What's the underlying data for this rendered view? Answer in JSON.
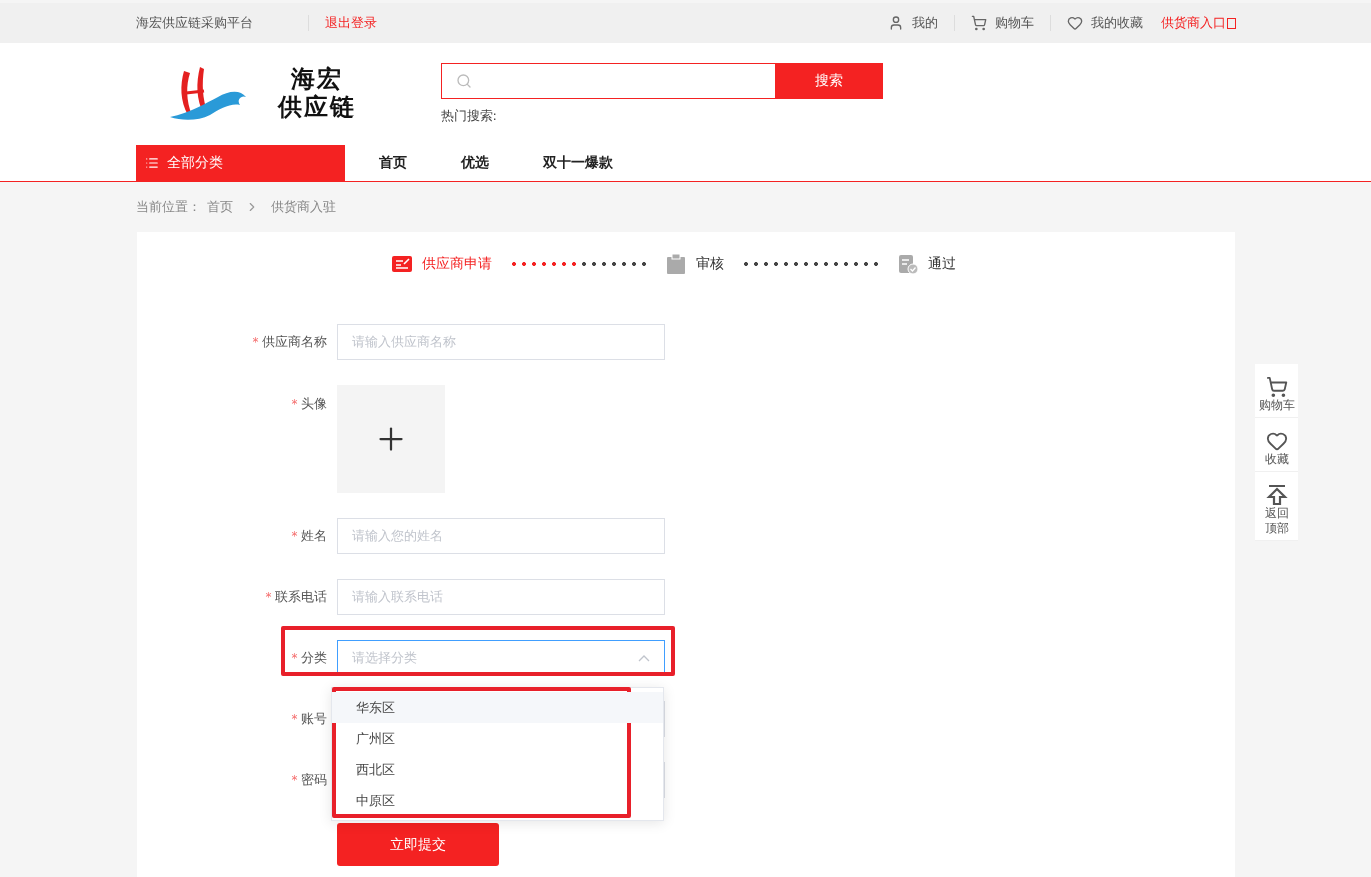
{
  "top_bar": {
    "platform": "海宏供应链采购平台",
    "logout": "退出登录",
    "links": [
      {
        "kind": "user",
        "label": "我的"
      },
      {
        "kind": "cart",
        "label": "购物车"
      },
      {
        "kind": "heart",
        "label": "我的收藏"
      }
    ],
    "supplier_entry": "供货商入口"
  },
  "header": {
    "logo": {
      "line1": "海宏",
      "line2": "供应链"
    },
    "search": {
      "button": "搜索",
      "hot_label": "热门搜索:"
    }
  },
  "nav": {
    "all_categories": "全部分类",
    "items": [
      {
        "label": "首页"
      },
      {
        "label": "优选"
      },
      {
        "label": "双十一爆款"
      }
    ]
  },
  "breadcrumb": {
    "prefix": "当前位置：",
    "items": [
      "首页",
      "供货商入驻"
    ]
  },
  "steps": [
    {
      "kind": "apply",
      "label": "供应商申请",
      "current": true
    },
    {
      "kind": "review",
      "label": "审核",
      "current": false
    },
    {
      "kind": "pass",
      "label": "通过",
      "current": false
    }
  ],
  "connectors": [
    {
      "level": 0.5
    }
  ],
  "form": {
    "fields": [
      {
        "kind": "text",
        "mark": "*",
        "label": "供应商名称",
        "placeholder": "请输入供应商名称"
      },
      {
        "kind": "upload",
        "mark": "*",
        "label": "头像"
      },
      {
        "kind": "text",
        "mark": "*",
        "label": "姓名",
        "placeholder": "请输入您的姓名"
      },
      {
        "kind": "text",
        "mark": "*",
        "label": "联系电话",
        "placeholder": "请输入联系电话"
      },
      {
        "kind": "select",
        "mark": "*",
        "label": "分类",
        "placeholder": "请选择分类",
        "expanded": true,
        "options": [
          {
            "label": "华东区",
            "highlighted": true
          },
          {
            "label": "广州区",
            "highlighted": false
          },
          {
            "label": "西北区",
            "highlighted": false
          },
          {
            "label": "中原区",
            "highlighted": false
          }
        ]
      },
      {
        "kind": "text",
        "mark": "*",
        "label": "账号"
      },
      {
        "kind": "text",
        "mark": "*",
        "label": "密码"
      }
    ],
    "submit": "立即提交"
  },
  "side_panel": [
    {
      "kind": "cart",
      "label": "购物车"
    },
    {
      "kind": "heart",
      "label": "收藏"
    },
    {
      "kind": "top",
      "label": "返回顶部"
    }
  ]
}
